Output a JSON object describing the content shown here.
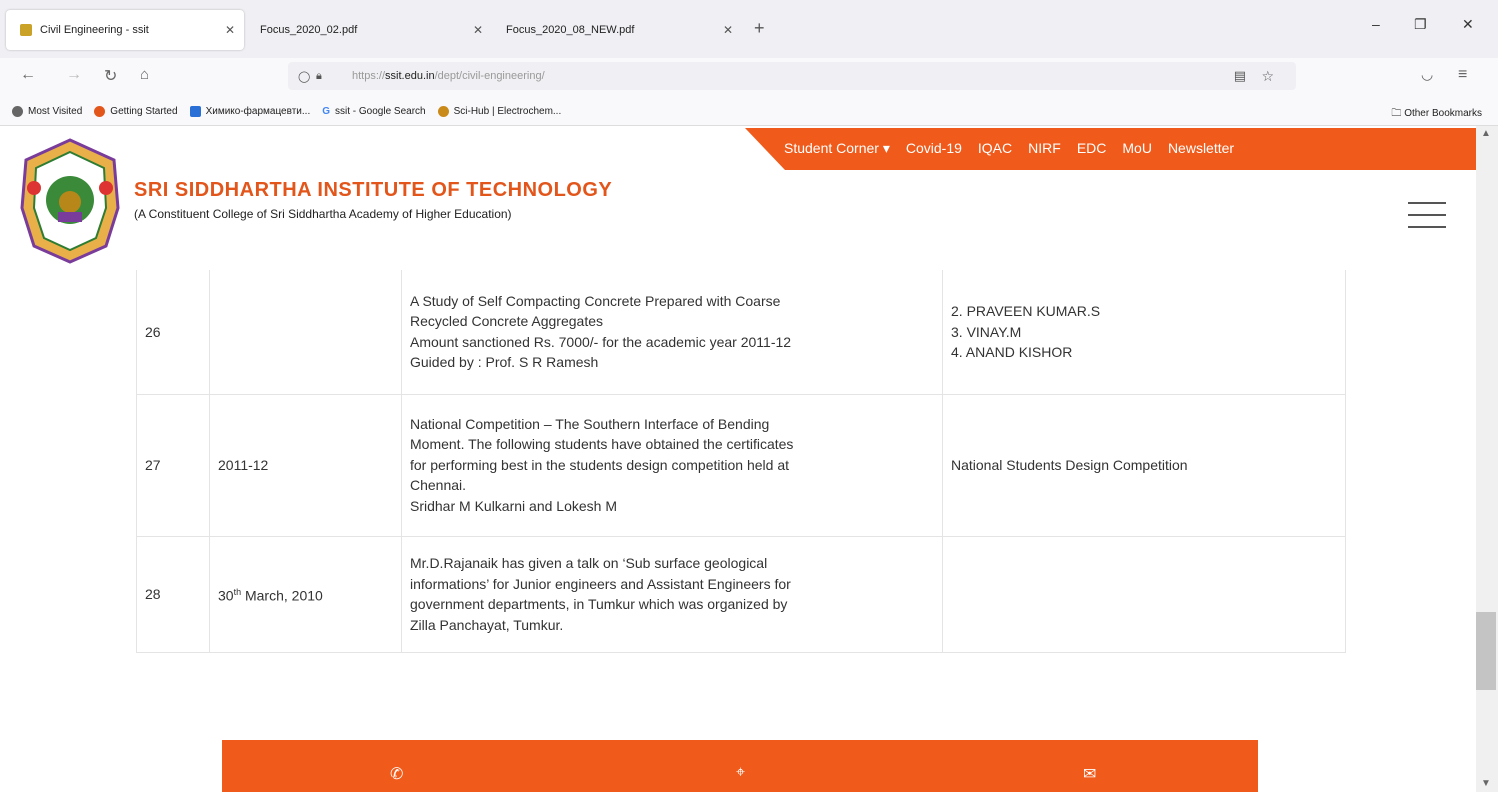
{
  "browser": {
    "tabs": [
      {
        "title": "Civil Engineering - ssit",
        "active": true
      },
      {
        "title": "Focus_2020_02.pdf",
        "active": false
      },
      {
        "title": "Focus_2020_08_NEW.pdf",
        "active": false
      }
    ],
    "new_tab": "+",
    "url_prefix": "https://",
    "url_host": "ssit.edu.in",
    "url_path": "/dept/civil-engineering/",
    "bookmarks": [
      {
        "label": "Most Visited",
        "color": "#666666"
      },
      {
        "label": "Getting Started",
        "color": "#e2561b"
      },
      {
        "label": "Химико-фармацевти...",
        "color": "#2a6fd6"
      },
      {
        "label": "ssit - Google Search",
        "color": "#4285f4"
      },
      {
        "label": "Sci-Hub | Electrochem...",
        "color": "#c98a1a"
      }
    ],
    "other_bookmarks": "Other Bookmarks"
  },
  "header": {
    "topnav": [
      "Student Corner ▾",
      "Covid-19",
      "IQAC",
      "NIRF",
      "EDC",
      "MoU",
      "Newsletter"
    ],
    "institute_name": "SRI SIDDHARTHA INSTITUTE OF TECHNOLOGY",
    "institute_subtitle": "(A Constituent College of Sri Siddhartha Academy of Higher Education)",
    "accent_color": "#f05a1a"
  },
  "table": {
    "rows": [
      {
        "num": "26",
        "date": "",
        "desc_lines": [
          "A Study of Self Compacting Concrete Prepared with Coarse",
          "Recycled Concrete Aggregates",
          "Amount sanctioned Rs. 7000/- for the academic year 2011-12",
          "Guided by : Prof. S R Ramesh"
        ],
        "who_lines": [
          "2. PRAVEEN KUMAR.S",
          "3. VINAY.M",
          "4. ANAND KISHOR"
        ]
      },
      {
        "num": "27",
        "date": "2011-12",
        "desc_lines": [
          "National Competition – The Southern Interface of Bending",
          "Moment. The following students have obtained the certificates",
          "for performing best in the students design competition held at",
          "Chennai.",
          "Sridhar M Kulkarni and  Lokesh M"
        ],
        "who_lines": [
          "National Students Design Competition"
        ]
      },
      {
        "num": "28",
        "date_day": "30",
        "date_sup": "th",
        "date_rest": " March, 2010",
        "desc_lines": [
          "Mr.D.Rajanaik has given a talk on ‘Sub surface geological",
          "informations’ for Junior engineers and Assistant Engineers for",
          "government departments, in Tumkur which was organized by",
          "Zilla Panchayat, Tumkur."
        ],
        "who_lines": []
      }
    ]
  },
  "footer": {
    "icons": [
      "phone-icon",
      "location-pin-icon",
      "mail-icon"
    ]
  }
}
